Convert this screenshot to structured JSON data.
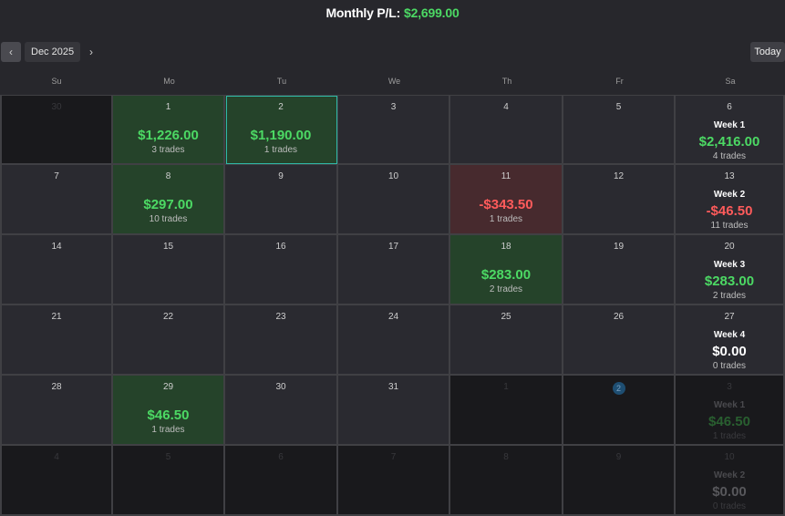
{
  "header": {
    "label": "Monthly P/L:",
    "value": "$2,699.00"
  },
  "toolbar": {
    "prev_icon": "chevron-left-icon",
    "next_icon": "chevron-right-icon",
    "month": "Dec 2025",
    "today_label": "Today"
  },
  "days_of_week": [
    "Su",
    "Mo",
    "Tu",
    "We",
    "Th",
    "Fr",
    "Sa"
  ],
  "weeks": [
    {
      "days": [
        {
          "day": "30",
          "state": "outside"
        },
        {
          "day": "1",
          "state": "profit",
          "amount": "$1,226.00",
          "trades": "3 trades"
        },
        {
          "day": "2",
          "state": "profit",
          "selected": true,
          "amount": "$1,190.00",
          "trades": "1 trades"
        },
        {
          "day": "3",
          "state": "normal"
        },
        {
          "day": "4",
          "state": "normal"
        },
        {
          "day": "5",
          "state": "normal"
        }
      ],
      "summary": {
        "day": "6",
        "state": "normal",
        "label": "Week 1",
        "amount": "$2,416.00",
        "tone": "green",
        "trades": "4 trades"
      }
    },
    {
      "days": [
        {
          "day": "7",
          "state": "normal"
        },
        {
          "day": "8",
          "state": "profit",
          "amount": "$297.00",
          "trades": "10 trades"
        },
        {
          "day": "9",
          "state": "normal"
        },
        {
          "day": "10",
          "state": "normal"
        },
        {
          "day": "11",
          "state": "loss",
          "amount": "-$343.50",
          "trades": "1 trades"
        },
        {
          "day": "12",
          "state": "normal"
        }
      ],
      "summary": {
        "day": "13",
        "state": "normal",
        "label": "Week 2",
        "amount": "-$46.50",
        "tone": "red",
        "trades": "11 trades"
      }
    },
    {
      "days": [
        {
          "day": "14",
          "state": "normal"
        },
        {
          "day": "15",
          "state": "normal"
        },
        {
          "day": "16",
          "state": "normal"
        },
        {
          "day": "17",
          "state": "normal"
        },
        {
          "day": "18",
          "state": "profit",
          "amount": "$283.00",
          "trades": "2 trades"
        },
        {
          "day": "19",
          "state": "normal"
        }
      ],
      "summary": {
        "day": "20",
        "state": "normal",
        "label": "Week 3",
        "amount": "$283.00",
        "tone": "green",
        "trades": "2 trades"
      }
    },
    {
      "days": [
        {
          "day": "21",
          "state": "normal"
        },
        {
          "day": "22",
          "state": "normal"
        },
        {
          "day": "23",
          "state": "normal"
        },
        {
          "day": "24",
          "state": "normal"
        },
        {
          "day": "25",
          "state": "normal"
        },
        {
          "day": "26",
          "state": "normal"
        }
      ],
      "summary": {
        "day": "27",
        "state": "normal",
        "label": "Week 4",
        "amount": "$0.00",
        "tone": "white",
        "trades": "0 trades"
      }
    },
    {
      "days": [
        {
          "day": "28",
          "state": "normal"
        },
        {
          "day": "29",
          "state": "profit",
          "amount": "$46.50",
          "trades": "1 trades"
        },
        {
          "day": "30",
          "state": "normal"
        },
        {
          "day": "31",
          "state": "normal"
        },
        {
          "day": "1",
          "state": "outside"
        },
        {
          "day": "2",
          "state": "outside",
          "today": true
        }
      ],
      "summary": {
        "day": "3",
        "state": "outside",
        "label": "Week 1",
        "amount": "$46.50",
        "tone": "green",
        "trades": "1 trades"
      }
    },
    {
      "days": [
        {
          "day": "4",
          "state": "outside"
        },
        {
          "day": "5",
          "state": "outside"
        },
        {
          "day": "6",
          "state": "outside"
        },
        {
          "day": "7",
          "state": "outside"
        },
        {
          "day": "8",
          "state": "outside"
        },
        {
          "day": "9",
          "state": "outside"
        }
      ],
      "summary": {
        "day": "10",
        "state": "outside",
        "label": "Week 2",
        "amount": "$0.00",
        "tone": "white",
        "trades": "0 trades"
      }
    }
  ],
  "colors": {
    "profit_text": "#4cd964",
    "loss_text": "#ff5b5b",
    "profit_bg": "#25432a",
    "loss_bg": "#472a2e",
    "selected_outline": "#30b8a8"
  }
}
